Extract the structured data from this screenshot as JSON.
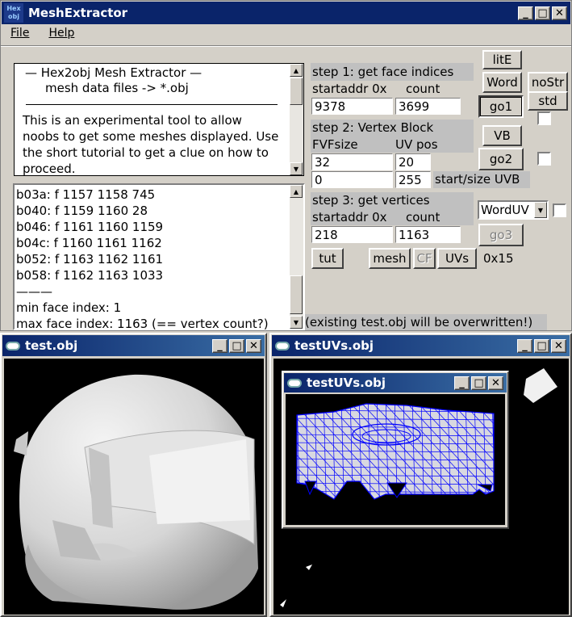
{
  "window": {
    "title": "MeshExtractor",
    "icon_text": "Hex obj"
  },
  "menu": [
    "File",
    "Help"
  ],
  "info_text": {
    "heading": "—   Hex2obj Mesh Extractor   —",
    "subheading": "mesh data files -> *.obj",
    "body": "This is an experimental tool to allow noobs to get some meshes displayed. Use the short tutorial to get a clue on how to proceed."
  },
  "log_lines": [
    "b03a: f  1157 1158 745",
    "b040: f  1159 1160 28",
    "b046: f  1161 1160 1159",
    "b04c: f  1160 1161 1162",
    "b052: f  1163 1162 1161",
    "b058: f  1162 1163 1033",
    "———",
    "min face index: 1",
    "max face index: 1163 (== vertex count?)"
  ],
  "step1": {
    "title": "step 1: get face indices",
    "addr_label": "startaddr 0x",
    "count_label": "count",
    "addr": "9378",
    "count": "3699"
  },
  "step2": {
    "title": "step 2: Vertex Block",
    "fvf_label": "FVFsize",
    "uvpos_label": "UV pos",
    "fvf": "32",
    "uvpos": "20",
    "uvb_start": "0",
    "uvb_size": "255",
    "uvb_label": "start/size UVB"
  },
  "step3": {
    "title": "step 3: get vertices",
    "addr_label": "startaddr 0x",
    "count_label": "count",
    "addr": "218",
    "count": "1163"
  },
  "buttons": {
    "litE": "litE",
    "word": "Word",
    "noStr": "noStr",
    "std": "std",
    "go1": "go1",
    "vb": "VB",
    "go2": "go2",
    "go3": "go3",
    "tut": "tut",
    "mesh": "mesh",
    "cf": "CF",
    "uvs": "UVs"
  },
  "select": {
    "value": "WordUV"
  },
  "hex_label": "0x15",
  "warning": "(existing test.obj will be overwritten!)",
  "viewer1": {
    "title": "test.obj"
  },
  "viewer2": {
    "title": "testUVs.obj"
  },
  "viewer2_inner": {
    "title": "testUVs.obj"
  },
  "colors": {
    "titlebar": "#0a246a",
    "wire": "#0000ff",
    "face": "#c8c8c8"
  }
}
